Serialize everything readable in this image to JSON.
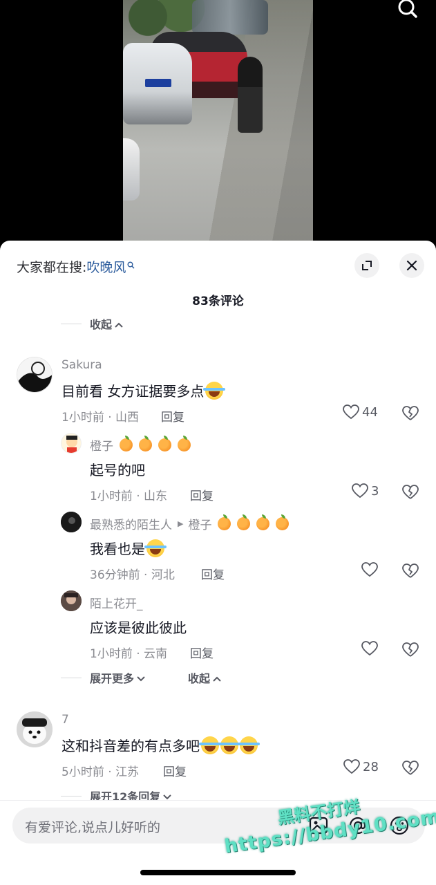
{
  "video": {
    "search_icon": "search-icon"
  },
  "header": {
    "everyone_search_prefix": "大家都在搜:",
    "everyone_search_keyword": "吹晚风",
    "comment_count_title": "83条评论",
    "collapse_top_label": "收起"
  },
  "comments": [
    {
      "username": "Sakura",
      "text": "目前看 女方证据要多点",
      "emoji": "laugh-cry",
      "meta": "1小时前 · 山西",
      "reply_label": "回复",
      "likes": "44",
      "replies": [
        {
          "username": "橙子",
          "username_emoji": "orange",
          "text": "起号的吧",
          "meta": "1小时前 · 山东",
          "reply_label": "回复",
          "likes": "3"
        },
        {
          "username": "最熟悉的陌生人",
          "reply_to": "橙子",
          "text": "我看也是",
          "meta": "36分钟前 · 河北",
          "reply_label": "回复",
          "likes": ""
        },
        {
          "username": "陌上花开_",
          "text": "应该是彼此彼此",
          "meta": "1小时前 · 云南",
          "reply_label": "回复",
          "likes": ""
        }
      ],
      "expand_more_label": "展开更多",
      "collapse_label": "收起"
    },
    {
      "username": "7",
      "text": "这和抖音差的有点多吧",
      "emoji": "laugh-cry x3",
      "meta": "5小时前 · 江苏",
      "reply_label": "回复",
      "likes": "28",
      "expand_replies_label": "展开12条回复"
    }
  ],
  "input": {
    "placeholder": "有爱评论,说点儿好听的"
  },
  "watermark": {
    "line1": "黑料不打烊",
    "line2": "https://bbdy10.com"
  },
  "colors": {
    "keyword_blue": "#2b5b9c",
    "muted_gray": "#8a8b91",
    "sheet_bg": "#ffffff",
    "watermark_teal": "#5fe0c4"
  }
}
